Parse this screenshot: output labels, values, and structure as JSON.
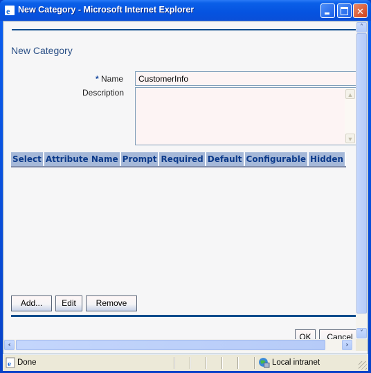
{
  "window": {
    "title": "New Category - Microsoft Internet Explorer",
    "controls": {
      "minimize": "_",
      "maximize": "□",
      "close": "✕"
    }
  },
  "form": {
    "page_title": "New Category",
    "required_marker": "*",
    "name_label": "Name",
    "name_value": "CustomerInfo",
    "description_label": "Description",
    "description_value": ""
  },
  "table": {
    "columns": [
      "Select",
      "Attribute Name",
      "Prompt",
      "Required",
      "Default",
      "Configurable",
      "Hidden"
    ],
    "rows": []
  },
  "buttons": {
    "add": "Add...",
    "edit": "Edit",
    "remove": "Remove",
    "ok": "OK",
    "cancel": "Cancel"
  },
  "statusbar": {
    "status": "Done",
    "zone": "Local intranet"
  },
  "colors": {
    "accent": "#0b4b8c",
    "header_bg": "#a5b8d8",
    "header_text": "#0c3a8a",
    "title_text": "#2a4f86"
  }
}
